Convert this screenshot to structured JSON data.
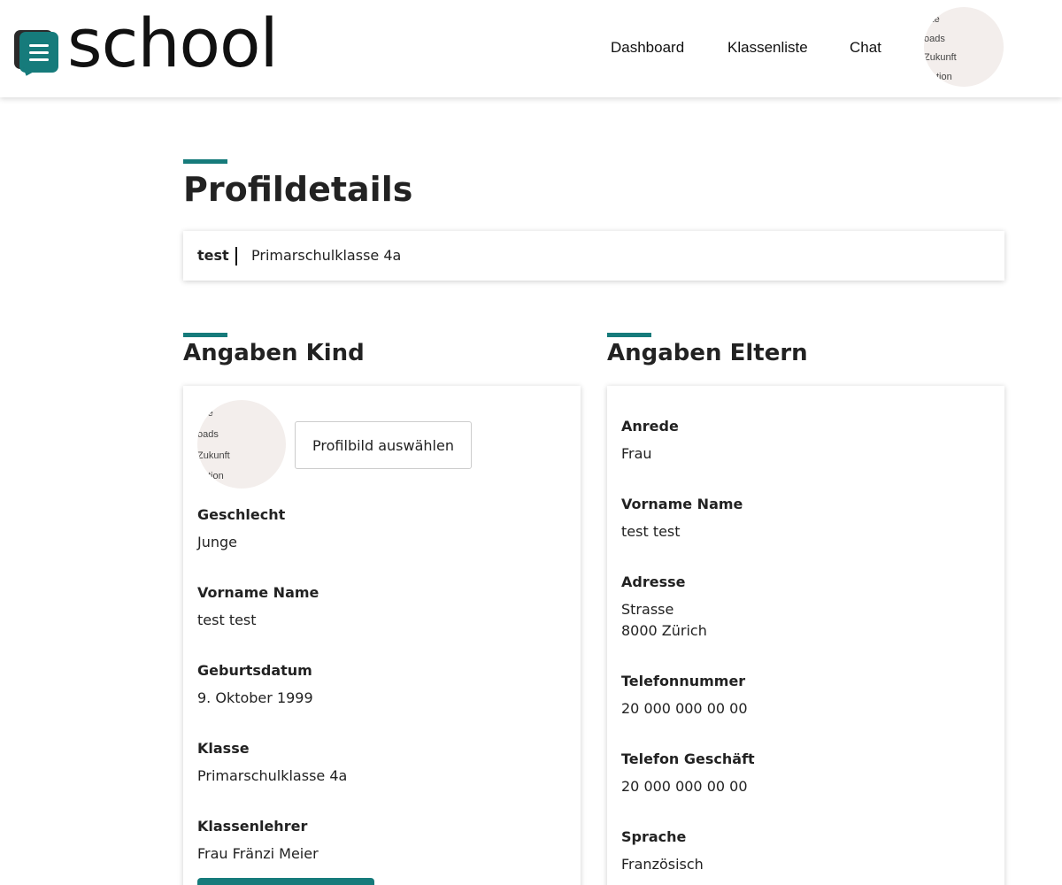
{
  "header": {
    "brand": "school",
    "nav": [
      {
        "label": "Dashboard"
      },
      {
        "label": "Klassenliste"
      },
      {
        "label": "Chat"
      }
    ],
    "avatar_text": [
      "inte",
      "oads",
      "Zukunft",
      "tion"
    ]
  },
  "page": {
    "title": "Profildetails"
  },
  "summary": {
    "name": "test",
    "class": "Primarschulklasse 4a"
  },
  "kind": {
    "title": "Angaben Kind",
    "avatar_text": [
      "inte",
      "oads",
      "Zukunft",
      "tion"
    ],
    "upload_label": "Profilbild auswählen",
    "fields": [
      {
        "label": "Geschlecht",
        "value": "Junge"
      },
      {
        "label": "Vorname Name",
        "value": "test test"
      },
      {
        "label": "Geburtsdatum",
        "value": "9. Oktober 1999"
      },
      {
        "label": "Klasse",
        "value": "Primarschulklasse 4a"
      },
      {
        "label": "Klassenlehrer",
        "value": "Frau Fränzi Meier"
      }
    ]
  },
  "eltern": {
    "title": "Angaben Eltern",
    "fields": [
      {
        "label": "Anrede",
        "value": "Frau"
      },
      {
        "label": "Vorname Name",
        "value": "test test"
      },
      {
        "label": "Adresse",
        "value": "Strasse",
        "value2": "8000 Zürich"
      },
      {
        "label": "Telefonnummer",
        "value": "20 000 000 00 00"
      },
      {
        "label": "Telefon Geschäft",
        "value": "20 000 000 00 00"
      },
      {
        "label": "Sprache",
        "value": "Französisch"
      }
    ]
  },
  "colors": {
    "accent": "#167b7b",
    "avatar_bg": "#f3eeec"
  },
  "icons": {
    "logo": "chat-bubbles-menu-icon"
  }
}
